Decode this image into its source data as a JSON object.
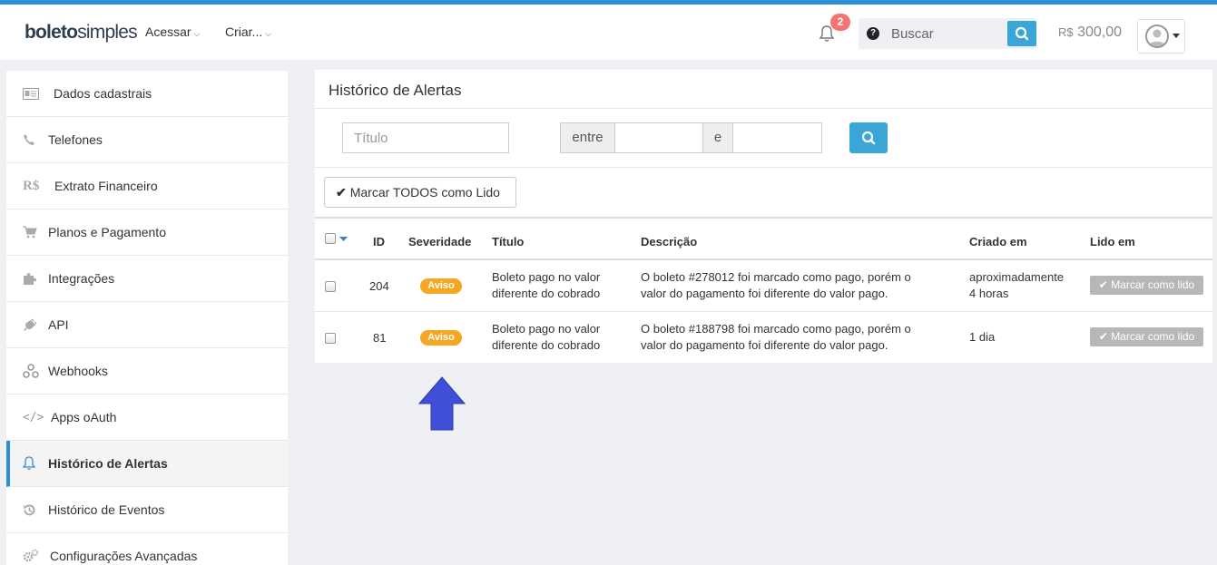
{
  "header": {
    "logo_bold": "boleto",
    "logo_light": "simples",
    "nav": [
      {
        "label": "Acessar"
      },
      {
        "label": "Criar..."
      }
    ],
    "notification_count": "2",
    "search_placeholder": "Buscar",
    "balance_currency": "R$",
    "balance_value": "300,00"
  },
  "sidebar": {
    "items": [
      {
        "label": "Dados cadastrais",
        "icon": "id-card-icon"
      },
      {
        "label": "Telefones",
        "icon": "phone-icon"
      },
      {
        "label": "Extrato Financeiro",
        "icon": "currency-icon",
        "icon_text": "R$"
      },
      {
        "label": "Planos e Pagamento",
        "icon": "cart-icon"
      },
      {
        "label": "Integrações",
        "icon": "puzzle-icon"
      },
      {
        "label": "API",
        "icon": "plug-icon"
      },
      {
        "label": "Webhooks",
        "icon": "webhook-icon"
      },
      {
        "label": "Apps oAuth",
        "icon": "code-icon",
        "icon_text": "</>"
      },
      {
        "label": "Histórico de Alertas",
        "icon": "bell-icon",
        "active": true
      },
      {
        "label": "Histórico de Eventos",
        "icon": "history-icon"
      },
      {
        "label": "Configurações Avançadas",
        "icon": "gears-icon"
      }
    ]
  },
  "panel": {
    "title": "Histórico de Alertas",
    "filters": {
      "title_placeholder": "Título",
      "between_label": "entre",
      "and_label": "e"
    },
    "mark_all_label": "Marcar TODOS como Lido",
    "table": {
      "columns": [
        "ID",
        "Severidade",
        "Título",
        "Descrição",
        "Criado em",
        "Lido em"
      ],
      "rows": [
        {
          "id": "204",
          "severity": "Aviso",
          "title_line1": "Boleto pago no valor",
          "title_line2": "diferente do cobrado",
          "desc_line1": "O boleto #278012 foi marcado como pago, porém o",
          "desc_line2": "valor do pagamento foi diferente do valor pago.",
          "created_line1": "aproximadamente",
          "created_line2": "4 horas",
          "action": "Marcar como lido"
        },
        {
          "id": "81",
          "severity": "Aviso",
          "title_line1": "Boleto pago no valor",
          "title_line2": "diferente do cobrado",
          "desc_line1": "O boleto #188798 foi marcado como pago, porém o",
          "desc_line2": "valor do pagamento foi diferente do valor pago.",
          "created_line1": "1 dia",
          "created_line2": "",
          "action": "Marcar como lido"
        }
      ]
    }
  },
  "colors": {
    "accent": "#2b8fd6",
    "button_blue": "#3aa6d8",
    "badge_warning": "#f5a623",
    "notification_badge": "#f47474",
    "annotation_arrow": "#3f4fd8"
  }
}
